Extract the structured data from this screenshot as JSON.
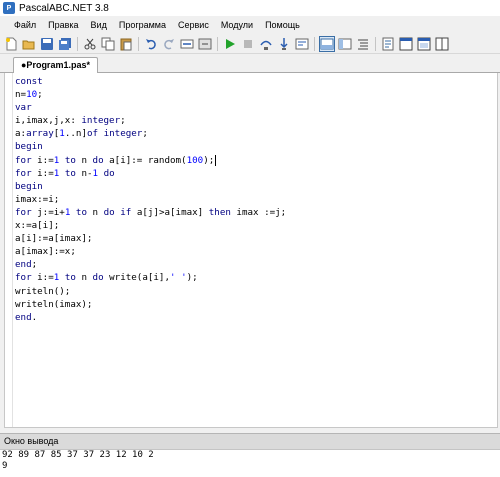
{
  "window": {
    "title": "PascalABC.NET 3.8",
    "app_icon_glyph": "P"
  },
  "menu": [
    {
      "label": "Файл"
    },
    {
      "label": "Правка"
    },
    {
      "label": "Вид"
    },
    {
      "label": "Программа"
    },
    {
      "label": "Сервис"
    },
    {
      "label": "Модули"
    },
    {
      "label": "Помощь"
    }
  ],
  "toolbar": {
    "icons": [
      "new-file-icon",
      "open-file-icon",
      "save-icon",
      "save-all-icon",
      "cut-icon",
      "copy-icon",
      "paste-icon",
      "undo-icon",
      "redo-icon",
      "navigate-icon",
      "compile-icon",
      "run-icon",
      "stop-icon",
      "step-over-icon",
      "step-into-icon",
      "toggle-output-icon",
      "debug-window-icon",
      "structure-icon",
      "format-icon",
      "form-designer-icon",
      "form-icon2",
      "form-icon3"
    ]
  },
  "tab": {
    "label": "●Program1.pas*"
  },
  "colors": {
    "keyword": "#000080",
    "number": "#0000ff",
    "accent": "#3a6ea5"
  },
  "code": {
    "lines": [
      [
        {
          "t": "const",
          "c": "kw"
        }
      ],
      [
        {
          "t": "n=",
          "c": ""
        },
        {
          "t": "10",
          "c": "num"
        },
        {
          "t": ";",
          "c": ""
        }
      ],
      [
        {
          "t": "var",
          "c": "kw"
        }
      ],
      [
        {
          "t": "i,imax,j,x: ",
          "c": ""
        },
        {
          "t": "integer",
          "c": "kw"
        },
        {
          "t": ";",
          "c": ""
        }
      ],
      [
        {
          "t": "a:",
          "c": ""
        },
        {
          "t": "array",
          "c": "kw"
        },
        {
          "t": "[",
          "c": ""
        },
        {
          "t": "1",
          "c": "num"
        },
        {
          "t": "..n]",
          "c": ""
        },
        {
          "t": "of",
          "c": "kw"
        },
        {
          "t": " ",
          "c": ""
        },
        {
          "t": "integer",
          "c": "kw"
        },
        {
          "t": ";",
          "c": ""
        }
      ],
      [
        {
          "t": "begin",
          "c": "kw"
        }
      ],
      [
        {
          "t": "for",
          "c": "kw"
        },
        {
          "t": " i:=",
          "c": ""
        },
        {
          "t": "1",
          "c": "num"
        },
        {
          "t": " ",
          "c": ""
        },
        {
          "t": "to",
          "c": "kw"
        },
        {
          "t": " n ",
          "c": ""
        },
        {
          "t": "do",
          "c": "kw"
        },
        {
          "t": " a[i]:= random(",
          "c": ""
        },
        {
          "t": "100",
          "c": "num"
        },
        {
          "t": ");",
          "c": ""
        },
        {
          "t": "|cursor|",
          "c": "cursor"
        }
      ],
      [
        {
          "t": "for",
          "c": "kw"
        },
        {
          "t": " i:=",
          "c": ""
        },
        {
          "t": "1",
          "c": "num"
        },
        {
          "t": " ",
          "c": ""
        },
        {
          "t": "to",
          "c": "kw"
        },
        {
          "t": " n-",
          "c": ""
        },
        {
          "t": "1",
          "c": "num"
        },
        {
          "t": " ",
          "c": ""
        },
        {
          "t": "do",
          "c": "kw"
        }
      ],
      [
        {
          "t": "begin",
          "c": "kw"
        }
      ],
      [
        {
          "t": "imax:=i;",
          "c": ""
        }
      ],
      [
        {
          "t": "for",
          "c": "kw"
        },
        {
          "t": " j:=i+",
          "c": ""
        },
        {
          "t": "1",
          "c": "num"
        },
        {
          "t": " ",
          "c": ""
        },
        {
          "t": "to",
          "c": "kw"
        },
        {
          "t": " n ",
          "c": ""
        },
        {
          "t": "do",
          "c": "kw"
        },
        {
          "t": " ",
          "c": ""
        },
        {
          "t": "if",
          "c": "kw"
        },
        {
          "t": " a[j]>a[imax] ",
          "c": ""
        },
        {
          "t": "then",
          "c": "kw"
        },
        {
          "t": " imax :=j;",
          "c": ""
        }
      ],
      [
        {
          "t": "x:=a[i];",
          "c": ""
        }
      ],
      [
        {
          "t": "a[i]:=a[imax];",
          "c": ""
        }
      ],
      [
        {
          "t": "a[imax]:=x;",
          "c": ""
        }
      ],
      [
        {
          "t": "end",
          "c": "kw"
        },
        {
          "t": ";",
          "c": ""
        }
      ],
      [
        {
          "t": "for",
          "c": "kw"
        },
        {
          "t": " i:=",
          "c": ""
        },
        {
          "t": "1",
          "c": "num"
        },
        {
          "t": " ",
          "c": ""
        },
        {
          "t": "to",
          "c": "kw"
        },
        {
          "t": " n ",
          "c": ""
        },
        {
          "t": "do",
          "c": "kw"
        },
        {
          "t": " write(a[i],",
          "c": ""
        },
        {
          "t": "' '",
          "c": "str"
        },
        {
          "t": ");",
          "c": ""
        }
      ],
      [
        {
          "t": "writeln();",
          "c": ""
        }
      ],
      [
        {
          "t": "writeln(imax);",
          "c": ""
        }
      ],
      [
        {
          "t": "end",
          "c": "kw"
        },
        {
          "t": ".",
          "c": ""
        }
      ]
    ]
  },
  "output": {
    "header": "Окно вывода",
    "lines": [
      "92 89 87 85 37 37 23 12 10 2",
      "9"
    ]
  }
}
